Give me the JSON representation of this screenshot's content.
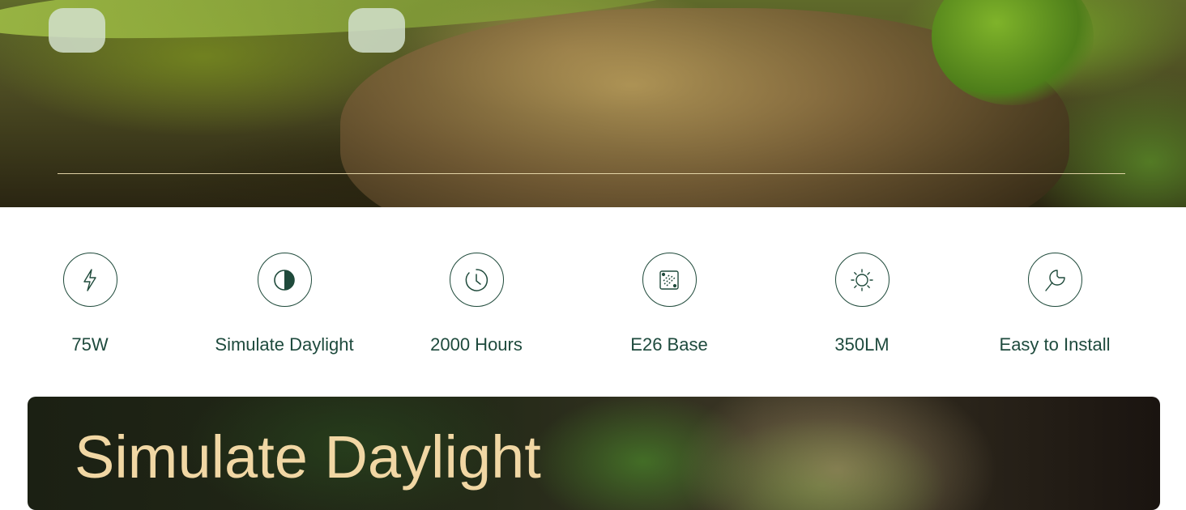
{
  "features": [
    {
      "icon": "lightning-icon",
      "label": "75W"
    },
    {
      "icon": "half-circle-icon",
      "label": "Simulate Daylight"
    },
    {
      "icon": "clock-icon",
      "label": "2000 Hours"
    },
    {
      "icon": "base-icon",
      "label": "E26 Base"
    },
    {
      "icon": "sun-icon",
      "label": "350LM"
    },
    {
      "icon": "wrench-icon",
      "label": "Easy to Install"
    }
  ],
  "banner": {
    "title": "Simulate Daylight"
  },
  "colors": {
    "accent": "#1e4a3d",
    "banner_title": "#f1d7a4",
    "divider": "#f0e1b4"
  }
}
